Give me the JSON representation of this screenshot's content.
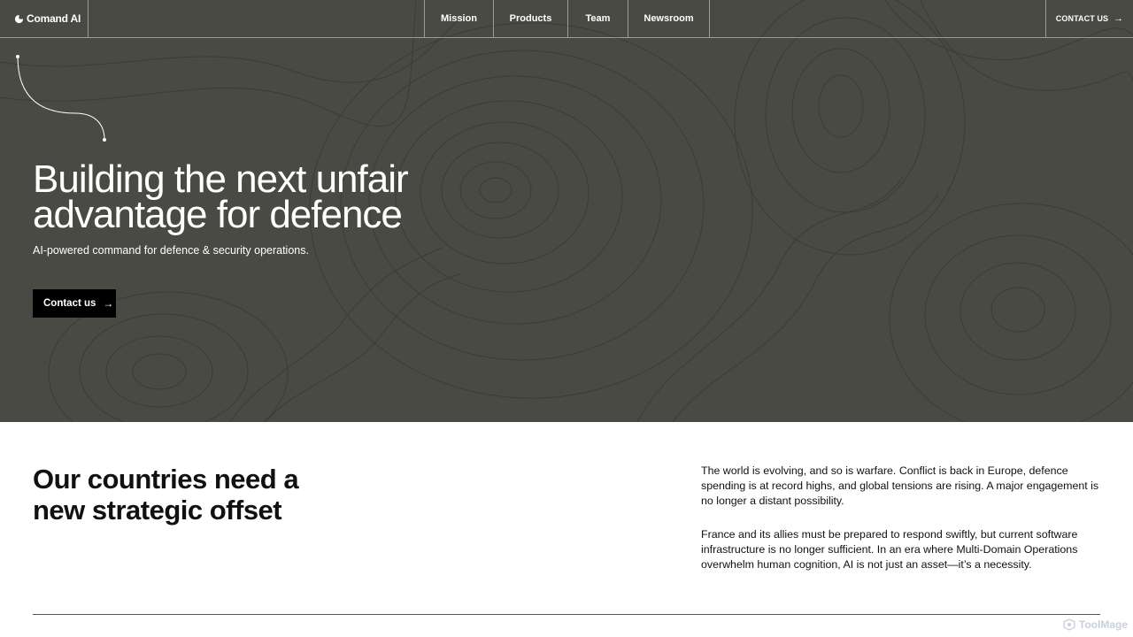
{
  "nav": {
    "brand": "Comand AI",
    "links": [
      "Mission",
      "Products",
      "Team",
      "Newsroom"
    ],
    "contact": "CONTACT US"
  },
  "hero": {
    "title_line1": "Building the next unfair",
    "title_line2": "advantage for defence",
    "subtitle": "AI-powered command for defence & security operations.",
    "cta": "Contact us"
  },
  "section2": {
    "title_line1": "Our countries need a",
    "title_line2": "new strategic offset",
    "paragraph1": "The world is evolving, and so is warfare. Conflict is back in Europe, defence spending is at record highs, and global tensions are rising. A major engagement is no longer a distant possibility.",
    "paragraph2": "France and its allies must be prepared to respond swiftly, but current software infrastructure is no longer sufficient. In an era where Multi-Domain Operations overwhelm human cognition, AI is not just an asset—it’s a necessity."
  },
  "watermark": "ToolMage",
  "colors": {
    "hero_bg": "#4a4a45",
    "button_bg": "#000000",
    "text_dark": "#111111"
  },
  "icons": {
    "brand": "brand-logo-icon",
    "arrow": "arrow-right-icon"
  }
}
